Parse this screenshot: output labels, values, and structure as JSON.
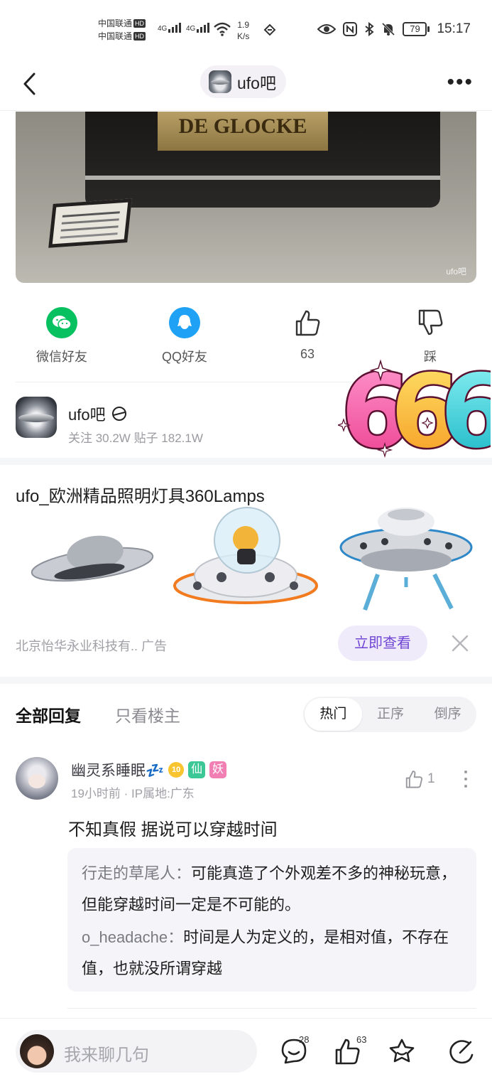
{
  "status_bar": {
    "carrier1": "中国联通",
    "carrier2": "中国联通",
    "hd": "HD",
    "net1": "4G",
    "net2": "4G",
    "speed_value": "1.9",
    "speed_unit": "K/s",
    "battery": "79",
    "time": "15:17"
  },
  "nav": {
    "forum_title": "ufo吧",
    "more": "..."
  },
  "post_image": {
    "plate_text": "DE GLOCKE",
    "watermark": "ufo吧"
  },
  "share": {
    "wechat": "微信好友",
    "qq": "QQ好友",
    "like_count": "63",
    "dislike": "踩"
  },
  "forum": {
    "name": "ufo吧",
    "stats": "关注 30.2W   贴子 182.1W"
  },
  "sticker": {
    "text": "666"
  },
  "ad": {
    "title": "ufo_欧洲精品照明灯具360Lamps",
    "sponsor": "北京怡华永业科技有..  广告",
    "cta": "立即查看"
  },
  "reply_tabs": {
    "all": "全部回复",
    "op_only": "只看楼主",
    "sort_hot": "热门",
    "sort_asc": "正序",
    "sort_desc": "倒序"
  },
  "comment": {
    "username": "幽灵系睡眠💤",
    "level": "10",
    "tag1": "仙",
    "tag2": "妖",
    "meta": "19小时前  ·  IP属地:广东",
    "like_count": "1",
    "text": "不知真假 据说可以穿越时间",
    "sub_replies": [
      {
        "who": "行走的草尾人：",
        "text": "可能真造了个外观差不多的神秘玩意，但能穿越时间一定是不可能的。"
      },
      {
        "who": "o_headache：",
        "text": "时间是人为定义的，是相对值，不存在值，也就没所谓穿越"
      }
    ]
  },
  "bottom_bar": {
    "placeholder": "我来聊几句",
    "comment_count": "28",
    "like_count": "63"
  },
  "colors": {
    "accent_purple": "#7046d4",
    "wechat_green": "#07c160",
    "qq_blue": "#1fa2f5"
  }
}
